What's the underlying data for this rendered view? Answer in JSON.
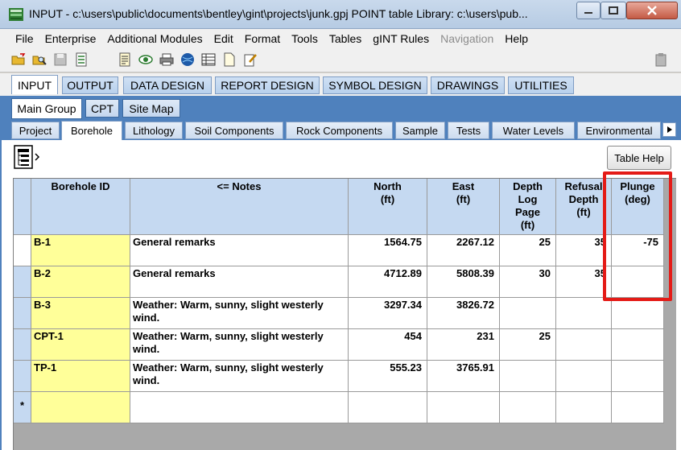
{
  "window": {
    "title": "INPUT -  c:\\users\\public\\documents\\bentley\\gint\\projects\\junk.gpj  POINT table  Library: c:\\users\\pub..."
  },
  "menu": [
    "File",
    "Enterprise",
    "Additional Modules",
    "Edit",
    "Format",
    "Tools",
    "Tables",
    "gINT Rules",
    "Navigation",
    "Help"
  ],
  "main_tabs": [
    "INPUT",
    "OUTPUT",
    "DATA DESIGN",
    "REPORT DESIGN",
    "SYMBOL DESIGN",
    "DRAWINGS",
    "UTILITIES"
  ],
  "group_tabs": [
    "Main Group",
    "CPT",
    "Site Map"
  ],
  "table_tabs": [
    "Project",
    "Borehole",
    "Lithology",
    "Soil Components",
    "Rock Components",
    "Sample",
    "Tests",
    "Water Levels",
    "Environmental"
  ],
  "buttons": {
    "table_help": "Table Help"
  },
  "grid": {
    "headers": {
      "borehole_id": "Borehole ID",
      "notes": "<=  Notes",
      "north": "North\n(ft)",
      "east": "East\n(ft)",
      "depth_log_page": "Depth\nLog\nPage\n(ft)",
      "refusal_depth": "Refusal\nDepth\n(ft)",
      "plunge": "Plunge\n(deg)"
    },
    "rows": [
      {
        "id": "B-1",
        "notes": "General remarks",
        "north": "1564.75",
        "east": "2267.12",
        "depth": "25",
        "refusal": "35",
        "plunge": "-75"
      },
      {
        "id": "B-2",
        "notes": "General remarks",
        "north": "4712.89",
        "east": "5808.39",
        "depth": "30",
        "refusal": "35",
        "plunge": ""
      },
      {
        "id": "B-3",
        "notes": "Weather:  Warm, sunny, slight westerly wind.",
        "north": "3297.34",
        "east": "3826.72",
        "depth": "",
        "refusal": "",
        "plunge": ""
      },
      {
        "id": "CPT-1",
        "notes": "Weather:  Warm, sunny, slight westerly wind.",
        "north": "454",
        "east": "231",
        "depth": "25",
        "refusal": "",
        "plunge": ""
      },
      {
        "id": "TP-1",
        "notes": "Weather:  Warm, sunny, slight westerly wind.",
        "north": "555.23",
        "east": "3765.91",
        "depth": "",
        "refusal": "",
        "plunge": ""
      }
    ],
    "new_row_marker": "*"
  },
  "colors": {
    "accent": "#4f81bd",
    "header": "#c5d9f1",
    "key_column": "#ffff99",
    "highlight": "#e41b17"
  }
}
